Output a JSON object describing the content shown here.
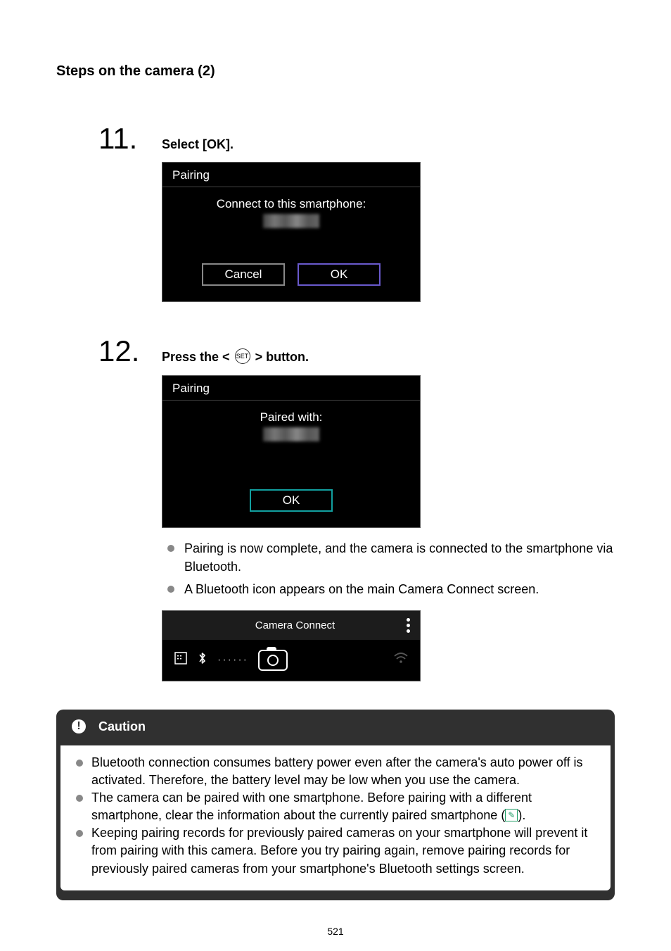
{
  "section_heading": "Steps on the camera (2)",
  "step11": {
    "number": "11.",
    "title": "Select [OK].",
    "screen": {
      "header": "Pairing",
      "message": "Connect to this smartphone:",
      "cancel": "Cancel",
      "ok": "OK"
    }
  },
  "step12": {
    "number": "12.",
    "title_pre": "Press the < ",
    "set_icon_text": "SET",
    "title_post": " > button.",
    "screen": {
      "header": "Pairing",
      "message": "Paired with:",
      "ok": "OK"
    },
    "bullet1": "Pairing is now complete, and the camera is connected to the smartphone via Bluetooth.",
    "bullet2": "A Bluetooth icon appears on the main Camera Connect screen.",
    "phone_title": "Camera Connect",
    "bt_glyph": "✲",
    "dots_text": "······"
  },
  "caution": {
    "title": "Caution",
    "icon_glyph": "!",
    "item1": "Bluetooth connection consumes battery power even after the camera's auto power off is activated. Therefore, the battery level may be low when you use the camera.",
    "item2_pre": "The camera can be paired with one smartphone. Before pairing with a different smartphone, clear the information about the currently paired smartphone (",
    "item2_post": ").",
    "link_glyph": "✎",
    "item3": "Keeping pairing records for previously paired cameras on your smartphone will prevent it from pairing with this camera. Before you try pairing again, remove pairing records for previously paired cameras from your smartphone's Bluetooth settings screen."
  },
  "page_number": "521"
}
